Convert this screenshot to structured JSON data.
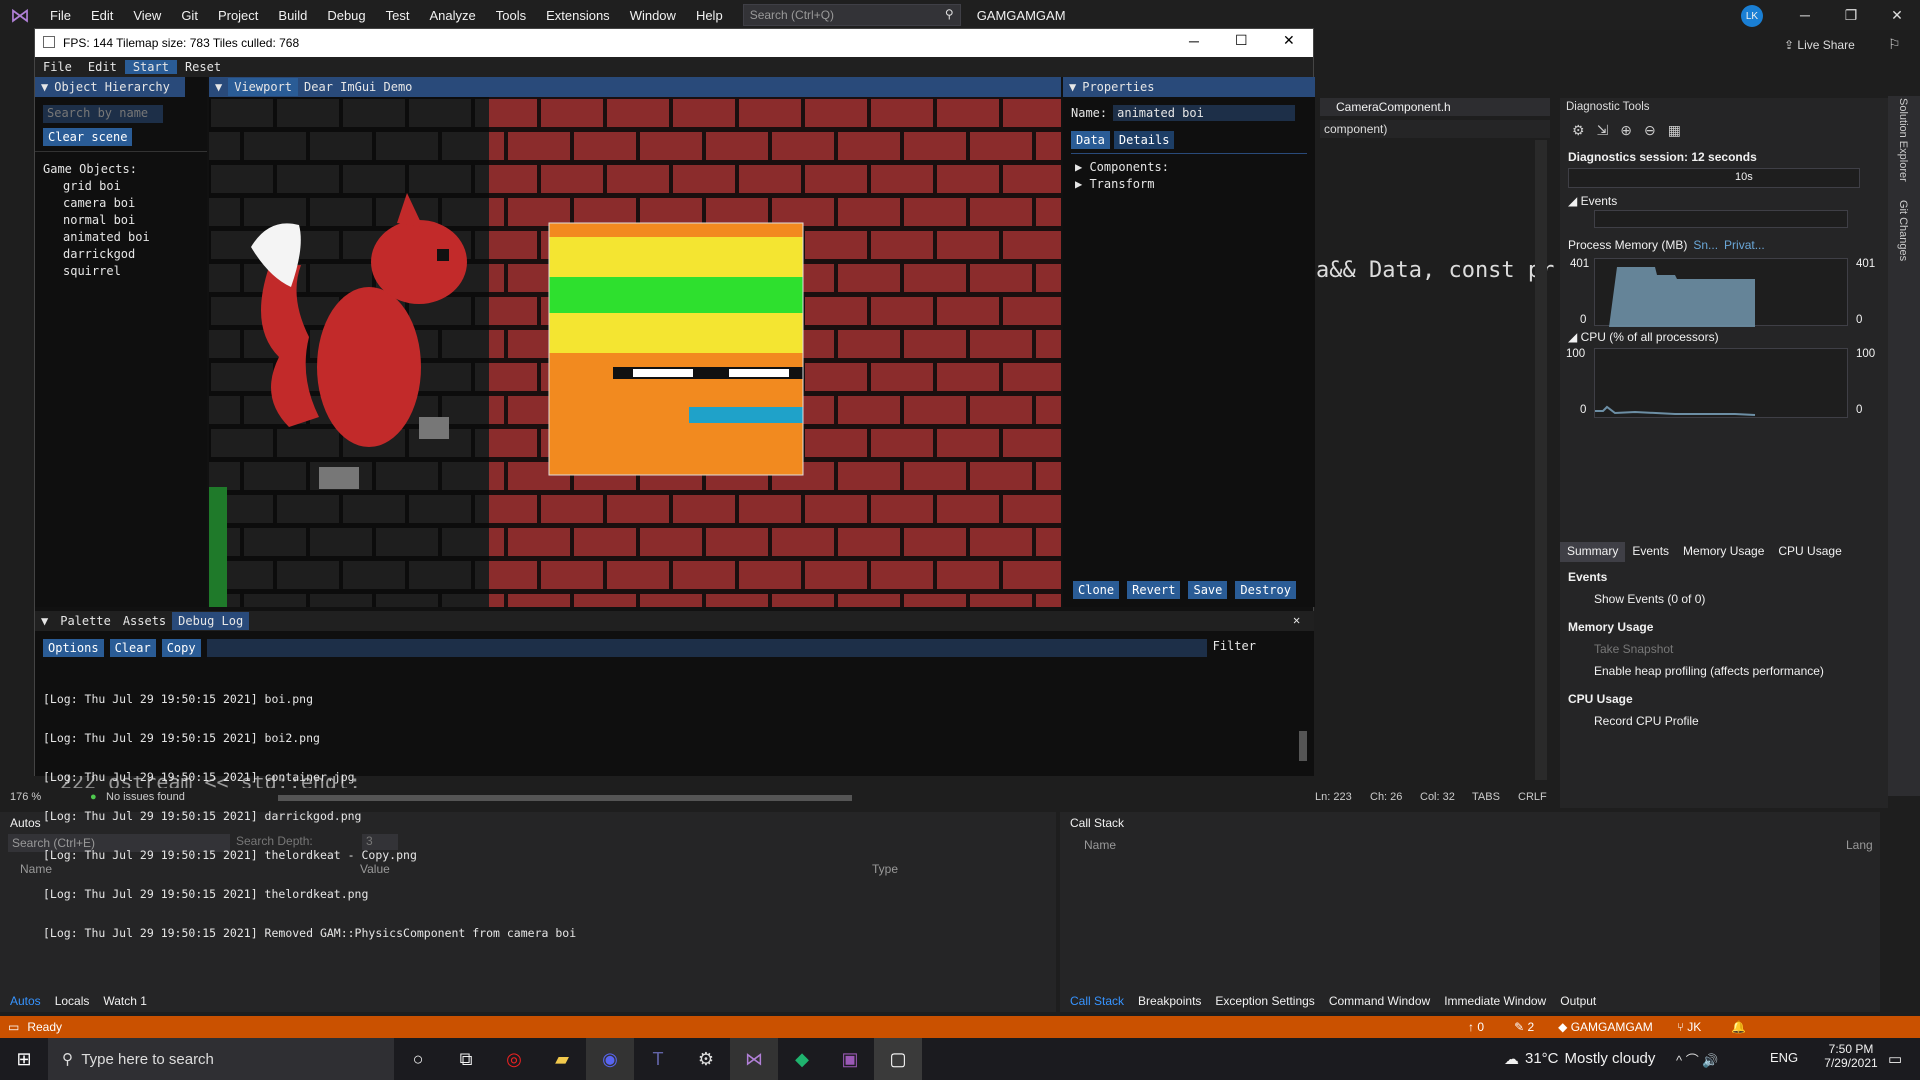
{
  "vs": {
    "menu": [
      "File",
      "Edit",
      "View",
      "Git",
      "Project",
      "Build",
      "Debug",
      "Test",
      "Analyze",
      "Tools",
      "Extensions",
      "Window",
      "Help"
    ],
    "search_placeholder": "Search (Ctrl+Q)",
    "solution_title": "GAMGAMGAM",
    "avatar": "LK",
    "live_share": "Live Share",
    "editor_tab": "CameraComponent.h",
    "editor_dropdown": "component)",
    "code_text": "a&& Data, const pr",
    "code_line": "222       ostream << std::endl;",
    "zoom": "176 %",
    "no_issues": "No issues found",
    "ln": "Ln: 223",
    "ch": "Ch: 26",
    "col": "Col: 32",
    "tabs": "TABS",
    "crlf": "CRLF"
  },
  "diagnostics": {
    "title": "Diagnostic Tools",
    "session": "Diagnostics session: 12 seconds",
    "timeline_label": "10s",
    "events": "Events",
    "memory_title": "Process Memory (MB)",
    "legend_snapshot": "Sn...",
    "legend_private": "Privat...",
    "mem_max": "401",
    "mem_min": "0",
    "cpu_title": "CPU (% of all processors)",
    "cpu_max": "100",
    "cpu_min": "0",
    "tabs": [
      "Summary",
      "Events",
      "Memory Usage",
      "CPU Usage"
    ],
    "sec_events": "Events",
    "show_events": "Show Events (0 of 0)",
    "sec_memory": "Memory Usage",
    "take_snapshot": "Take Snapshot",
    "heap_profiling": "Enable heap profiling (affects performance)",
    "sec_cpu": "CPU Usage",
    "record_cpu": "Record CPU Profile",
    "side_labels": [
      "Solution Explorer",
      "Git Changes"
    ]
  },
  "autos": {
    "title": "Autos",
    "search": "Search (Ctrl+E)",
    "depth_label": "Search Depth:",
    "depth_value": "3",
    "cols": [
      "Name",
      "Value",
      "Type"
    ],
    "tabs": [
      "Autos",
      "Locals",
      "Watch 1"
    ]
  },
  "callstack": {
    "title": "Call Stack",
    "cols": [
      "Name",
      "Lang"
    ],
    "tabs": [
      "Call Stack",
      "Breakpoints",
      "Exception Settings",
      "Command Window",
      "Immediate Window",
      "Output"
    ]
  },
  "status": {
    "ready": "Ready",
    "up": "0",
    "pencil": "2",
    "repo": "GAMGAMGAM",
    "branch": "JK"
  },
  "taskbar": {
    "search": "Type here to search",
    "temp": "31°C",
    "weather": "Mostly cloudy",
    "lang": "ENG",
    "time": "7:50 PM",
    "date": "7/29/2021"
  },
  "game": {
    "title": "FPS: 144 Tilemap size: 783 Tiles culled: 768",
    "menu": [
      "File",
      "Edit",
      "Start",
      "Reset"
    ],
    "hierarchy": {
      "title": "Object Hierarchy",
      "search": "Search by name",
      "clear": "Clear scene",
      "label": "Game Objects:",
      "items": [
        "grid boi",
        "camera boi",
        "normal boi",
        "animated boi",
        "darrickgod",
        "squirrel"
      ]
    },
    "viewport_tabs": [
      "Viewport",
      "Dear ImGui Demo"
    ],
    "properties": {
      "title": "Properties",
      "name_label": "Name:",
      "name_value": "animated boi",
      "tabs": [
        "Data",
        "Details"
      ],
      "tree": [
        "Components:",
        "Transform"
      ],
      "buttons": [
        "Clone",
        "Revert",
        "Save",
        "Destroy"
      ]
    },
    "log": {
      "tabs": [
        "Palette",
        "Assets",
        "Debug Log"
      ],
      "buttons": [
        "Options",
        "Clear",
        "Copy"
      ],
      "filter": "Filter",
      "lines": [
        "[Log: Thu Jul 29 19:50:15 2021] boi.png",
        "[Log: Thu Jul 29 19:50:15 2021] boi2.png",
        "[Log: Thu Jul 29 19:50:15 2021] container.jpg",
        "[Log: Thu Jul 29 19:50:15 2021] darrickgod.png",
        "[Log: Thu Jul 29 19:50:15 2021] thelordkeat - Copy.png",
        "[Log: Thu Jul 29 19:50:15 2021] thelordkeat.png",
        "[Log: Thu Jul 29 19:50:15 2021] Removed GAM::PhysicsComponent from camera boi"
      ]
    }
  },
  "colors": {
    "accent": "#ca5100",
    "imgui_blue": "#2a5c96",
    "brick": "#8b2c2c"
  }
}
